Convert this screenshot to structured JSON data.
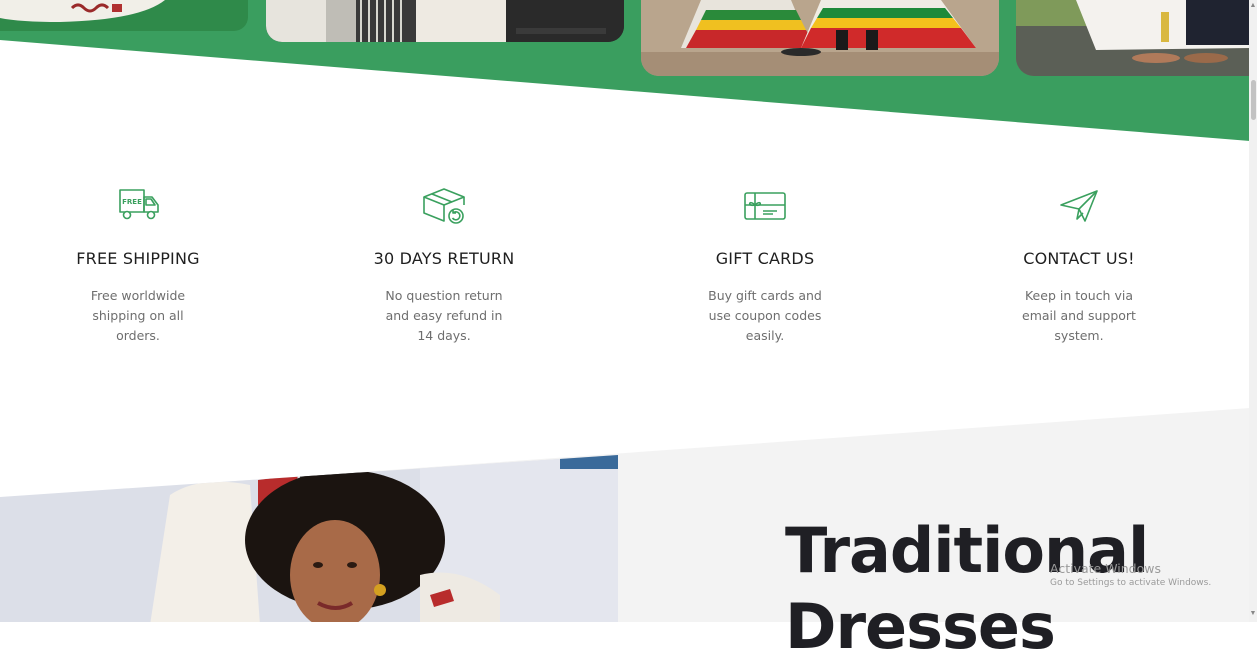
{
  "colors": {
    "accent": "#3aa05e",
    "band": "#3a9e5f",
    "heading": "#1f1f24",
    "muted": "#6e6e6e"
  },
  "features": [
    {
      "icon": "free-delivery-truck-icon",
      "icon_text": "FREE",
      "title": "FREE SHIPPING",
      "text": "Free worldwide shipping on all orders."
    },
    {
      "icon": "return-box-icon",
      "title": "30 DAYS RETURN",
      "text": "No question return and easy refund in 14 days."
    },
    {
      "icon": "gift-card-icon",
      "title": "GIFT CARDS",
      "text": "Buy gift cards and use coupon codes easily."
    },
    {
      "icon": "paper-plane-icon",
      "title": "CONTACT US!",
      "text": "Keep in touch via email and support system."
    }
  ],
  "promo": {
    "heading_line1": "Traditional",
    "heading_line2": "Dresses"
  },
  "os_watermark": {
    "title": "Activate Windows",
    "subtitle": "Go to Settings to activate Windows."
  }
}
